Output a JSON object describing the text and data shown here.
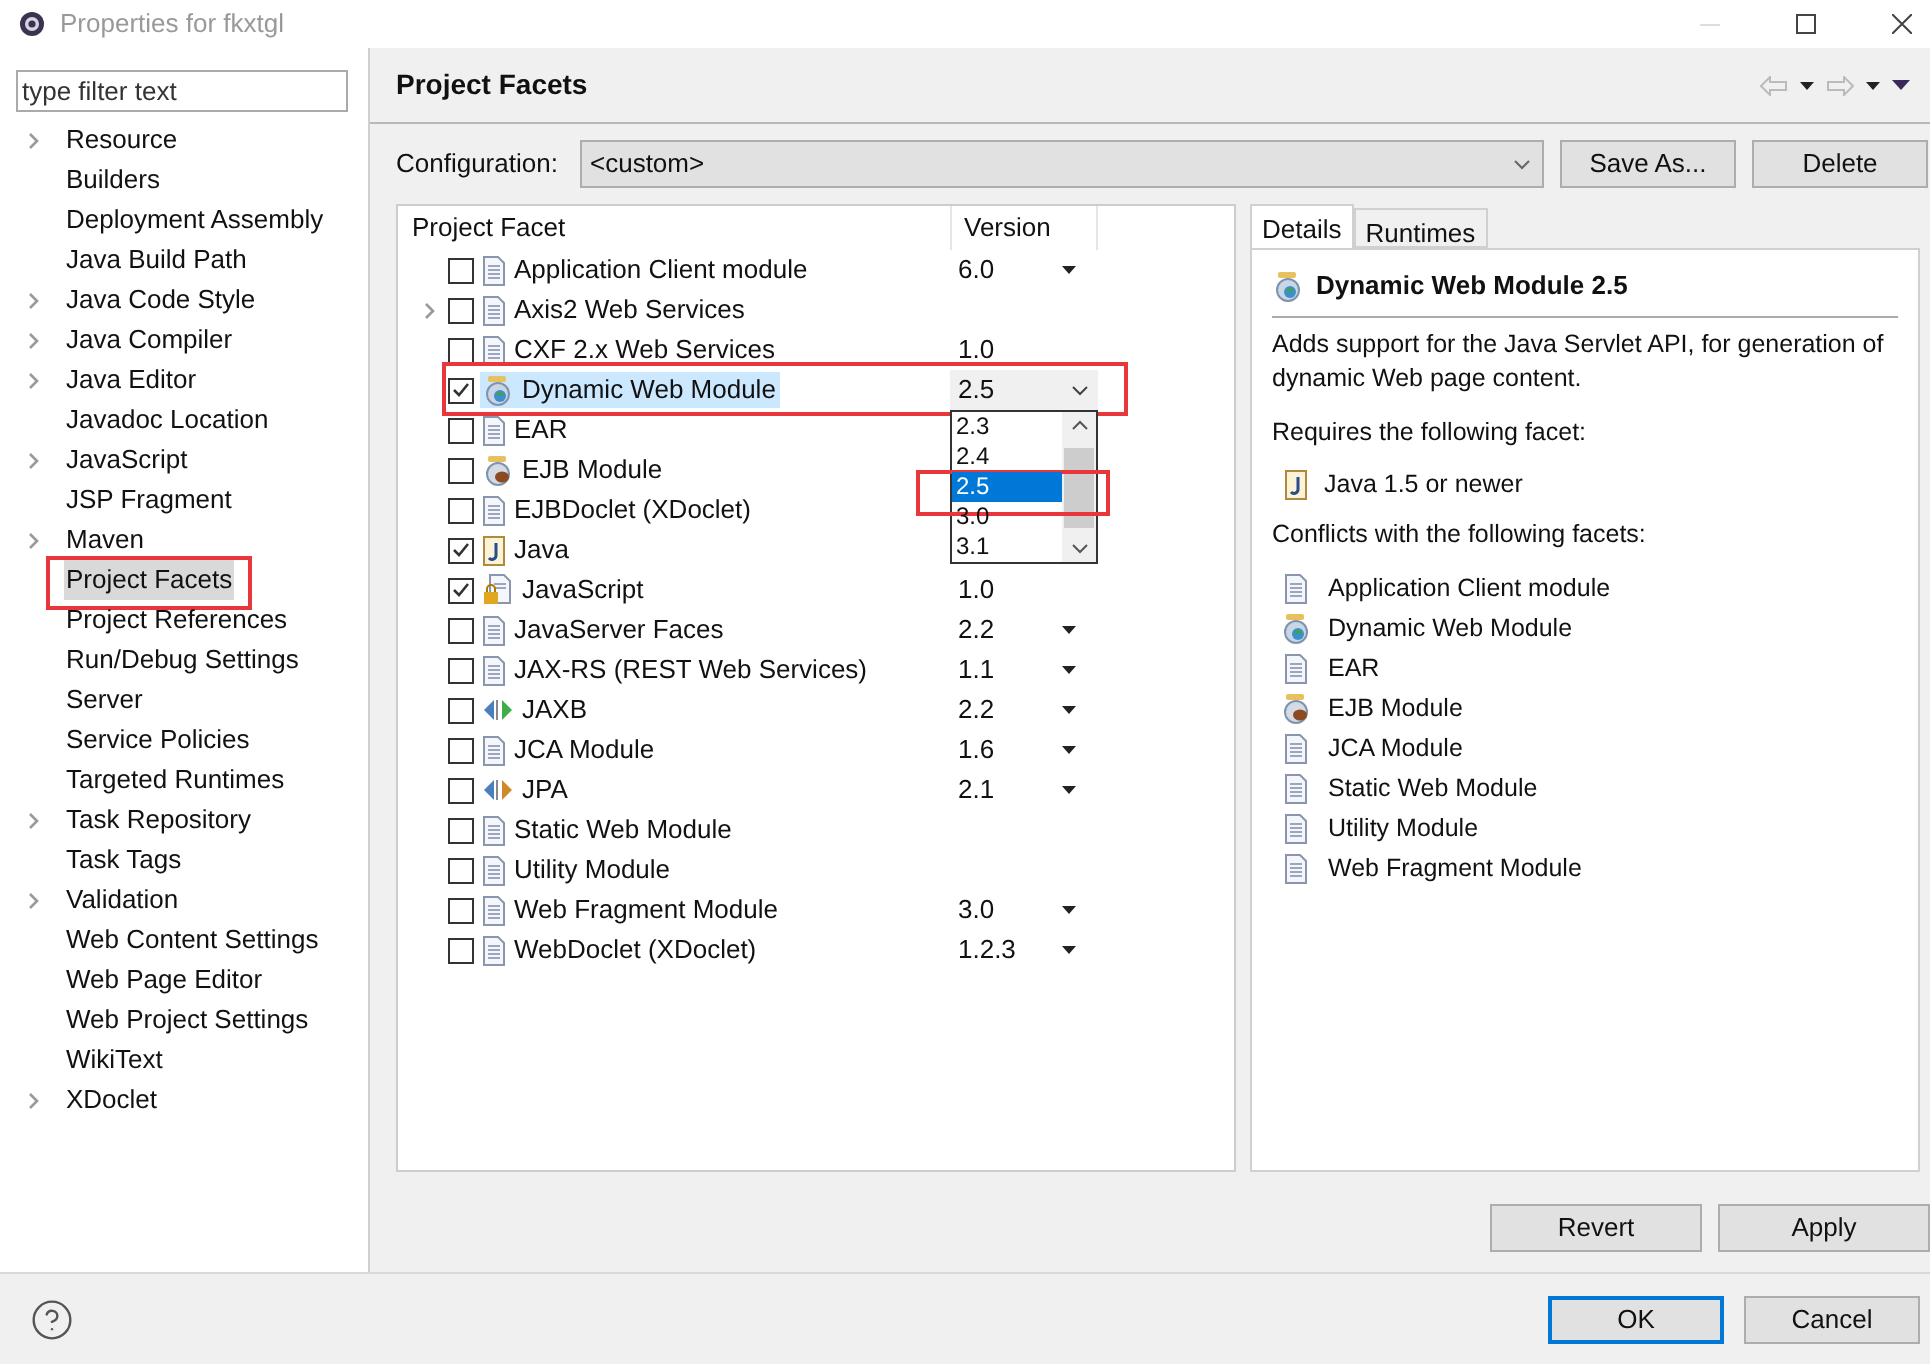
{
  "window": {
    "title": "Properties for fkxtgl"
  },
  "sidebar": {
    "filter": {
      "placeholder": "type filter text"
    },
    "items": [
      {
        "label": "Resource",
        "expandable": true,
        "selected": false,
        "annotated": false
      },
      {
        "label": "Builders",
        "expandable": false,
        "selected": false,
        "annotated": false
      },
      {
        "label": "Deployment Assembly",
        "expandable": false,
        "selected": false,
        "annotated": false
      },
      {
        "label": "Java Build Path",
        "expandable": false,
        "selected": false,
        "annotated": false
      },
      {
        "label": "Java Code Style",
        "expandable": true,
        "selected": false,
        "annotated": false
      },
      {
        "label": "Java Compiler",
        "expandable": true,
        "selected": false,
        "annotated": false
      },
      {
        "label": "Java Editor",
        "expandable": true,
        "selected": false,
        "annotated": false
      },
      {
        "label": "Javadoc Location",
        "expandable": false,
        "selected": false,
        "annotated": false
      },
      {
        "label": "JavaScript",
        "expandable": true,
        "selected": false,
        "annotated": false
      },
      {
        "label": "JSP Fragment",
        "expandable": false,
        "selected": false,
        "annotated": false
      },
      {
        "label": "Maven",
        "expandable": true,
        "selected": false,
        "annotated": false
      },
      {
        "label": "Project Facets",
        "expandable": false,
        "selected": true,
        "annotated": true
      },
      {
        "label": "Project References",
        "expandable": false,
        "selected": false,
        "annotated": false
      },
      {
        "label": "Run/Debug Settings",
        "expandable": false,
        "selected": false,
        "annotated": false
      },
      {
        "label": "Server",
        "expandable": false,
        "selected": false,
        "annotated": false
      },
      {
        "label": "Service Policies",
        "expandable": false,
        "selected": false,
        "annotated": false
      },
      {
        "label": "Targeted Runtimes",
        "expandable": false,
        "selected": false,
        "annotated": false
      },
      {
        "label": "Task Repository",
        "expandable": true,
        "selected": false,
        "annotated": false
      },
      {
        "label": "Task Tags",
        "expandable": false,
        "selected": false,
        "annotated": false
      },
      {
        "label": "Validation",
        "expandable": true,
        "selected": false,
        "annotated": false
      },
      {
        "label": "Web Content Settings",
        "expandable": false,
        "selected": false,
        "annotated": false
      },
      {
        "label": "Web Page Editor",
        "expandable": false,
        "selected": false,
        "annotated": false
      },
      {
        "label": "Web Project Settings",
        "expandable": false,
        "selected": false,
        "annotated": false
      },
      {
        "label": "WikiText",
        "expandable": false,
        "selected": false,
        "annotated": false
      },
      {
        "label": "XDoclet",
        "expandable": true,
        "selected": false,
        "annotated": false
      }
    ]
  },
  "page": {
    "title": "Project Facets",
    "configuration": {
      "label": "Configuration:",
      "value": "<custom>"
    },
    "buttons": [
      "Save As...",
      "Delete"
    ],
    "table": {
      "columns": [
        "Project Facet",
        "Version"
      ],
      "rows": [
        {
          "name": "Application Client module",
          "kind": "doc",
          "version": "6.0",
          "has_dropdown": true,
          "checked": false,
          "expandable": false,
          "selected": false,
          "annotated": false
        },
        {
          "name": "Axis2 Web Services",
          "kind": "doc",
          "checked": false,
          "has_dropdown": false,
          "expandable": true,
          "selected": false,
          "annotated": false
        },
        {
          "name": "CXF 2.x Web Services",
          "kind": "doc",
          "version": "1.0",
          "has_dropdown": false,
          "checked": false,
          "expandable": false,
          "selected": false,
          "annotated": false
        },
        {
          "name": "Dynamic Web Module",
          "kind": "web",
          "version": "2.5",
          "has_dropdown": true,
          "checked": true,
          "expandable": false,
          "selected": true,
          "annotated": true,
          "dropdown": [
            {
              "label": "2.3",
              "selected": false,
              "annotated": false
            },
            {
              "label": "2.4",
              "selected": false,
              "annotated": false
            },
            {
              "label": "2.5",
              "selected": true,
              "annotated": true
            },
            {
              "label": "3.0",
              "selected": false,
              "annotated": false
            },
            {
              "label": "3.1",
              "selected": false,
              "annotated": false
            }
          ]
        },
        {
          "name": "EAR",
          "kind": "doc",
          "checked": false,
          "has_dropdown": false,
          "expandable": false,
          "selected": false,
          "annotated": false
        },
        {
          "name": "EJB Module",
          "kind": "ejb",
          "checked": false,
          "has_dropdown": false,
          "expandable": false,
          "selected": false,
          "annotated": false
        },
        {
          "name": "EJBDoclet (XDoclet)",
          "kind": "doc",
          "checked": false,
          "has_dropdown": false,
          "expandable": false,
          "selected": false,
          "annotated": false
        },
        {
          "name": "Java",
          "kind": "java",
          "checked": true,
          "has_dropdown": false,
          "expandable": false,
          "selected": false,
          "annotated": false
        },
        {
          "name": "JavaScript",
          "kind": "js",
          "version": "1.0",
          "checked": true,
          "has_dropdown": false,
          "expandable": false,
          "selected": false,
          "annotated": false
        },
        {
          "name": "JavaServer Faces",
          "kind": "doc",
          "version": "2.2",
          "has_dropdown": true,
          "checked": false,
          "expandable": false,
          "selected": false,
          "annotated": false
        },
        {
          "name": "JAX-RS (REST Web Services)",
          "kind": "doc",
          "version": "1.1",
          "has_dropdown": true,
          "checked": false,
          "expandable": false,
          "selected": false,
          "annotated": false
        },
        {
          "name": "JAXB",
          "kind": "jaxb",
          "version": "2.2",
          "has_dropdown": true,
          "checked": false,
          "expandable": false,
          "selected": false,
          "annotated": false
        },
        {
          "name": "JCA Module",
          "kind": "doc",
          "version": "1.6",
          "has_dropdown": true,
          "checked": false,
          "expandable": false,
          "selected": false,
          "annotated": false
        },
        {
          "name": "JPA",
          "kind": "jpa",
          "version": "2.1",
          "has_dropdown": true,
          "checked": false,
          "expandable": false,
          "selected": false,
          "annotated": false
        },
        {
          "name": "Static Web Module",
          "kind": "doc",
          "checked": false,
          "has_dropdown": false,
          "expandable": false,
          "selected": false,
          "annotated": false
        },
        {
          "name": "Utility Module",
          "kind": "doc",
          "checked": false,
          "has_dropdown": false,
          "expandable": false,
          "selected": false,
          "annotated": false
        },
        {
          "name": "Web Fragment Module",
          "kind": "doc",
          "version": "3.0",
          "has_dropdown": true,
          "checked": false,
          "expandable": false,
          "selected": false,
          "annotated": false
        },
        {
          "name": "WebDoclet (XDoclet)",
          "kind": "doc",
          "version": "1.2.3",
          "has_dropdown": true,
          "checked": false,
          "expandable": false,
          "selected": false,
          "annotated": false
        }
      ]
    },
    "details": {
      "tabs": [
        {
          "label": "Details",
          "selected": true
        },
        {
          "label": "Runtimes",
          "selected": false
        }
      ],
      "header": {
        "title": "Dynamic Web Module 2.5",
        "kind": "web"
      },
      "description": "Adds support for the Java Servlet API, for generation of dynamic Web page content.",
      "requires_heading": "Requires the following facet:",
      "requires": [
        {
          "label": "Java 1.5 or newer",
          "kind": "java"
        }
      ],
      "conflicts_heading": "Conflicts with the following facets:",
      "conflicts": [
        {
          "label": "Application Client module",
          "kind": "doc"
        },
        {
          "label": "Dynamic Web Module",
          "kind": "web"
        },
        {
          "label": "EAR",
          "kind": "doc"
        },
        {
          "label": "EJB Module",
          "kind": "ejb"
        },
        {
          "label": "JCA Module",
          "kind": "doc"
        },
        {
          "label": "Static Web Module",
          "kind": "doc"
        },
        {
          "label": "Utility Module",
          "kind": "doc"
        },
        {
          "label": "Web Fragment Module",
          "kind": "doc"
        }
      ]
    },
    "page_buttons": [
      "Revert",
      "Apply"
    ]
  },
  "footer": {
    "buttons": [
      {
        "label": "OK",
        "default": true
      },
      {
        "label": "Cancel",
        "default": false
      }
    ]
  }
}
